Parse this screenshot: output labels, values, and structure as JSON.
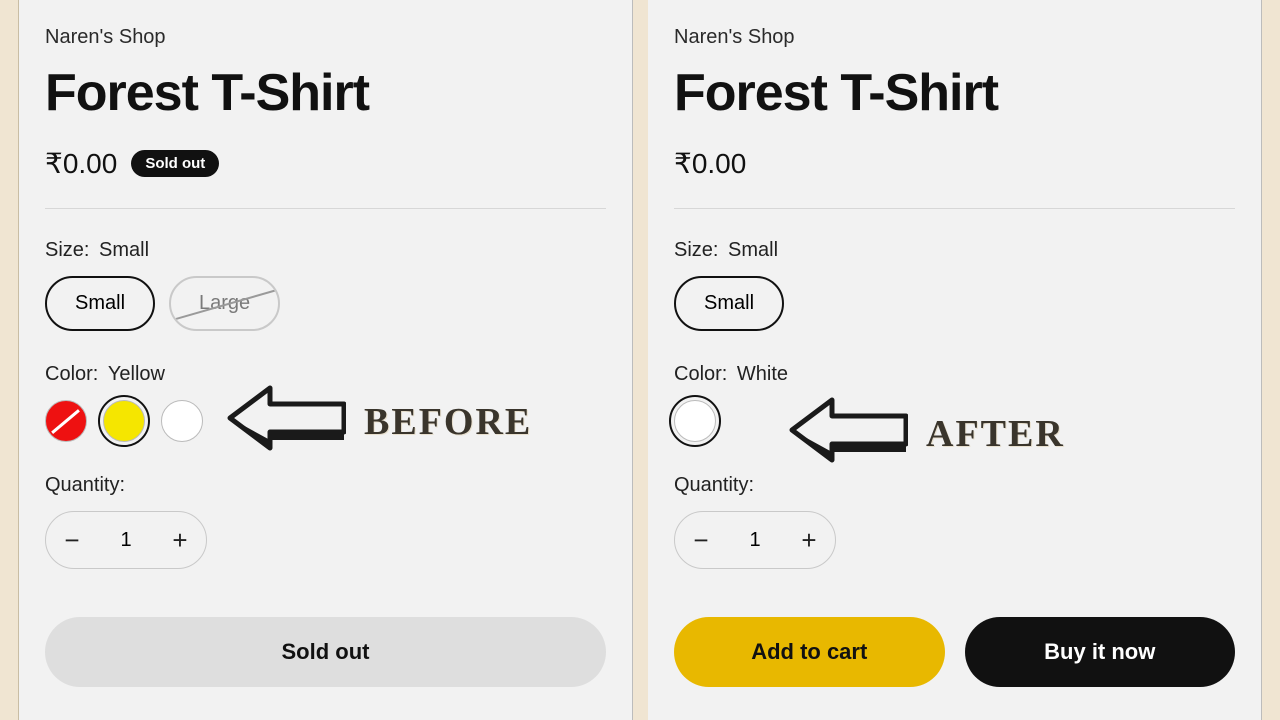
{
  "annotations": {
    "before": "BEFORE",
    "after": "AFTER"
  },
  "before": {
    "shop": "Naren's Shop",
    "title": "Forest T-Shirt",
    "price": "₹0.00",
    "soldout_badge": "Sold out",
    "size_label": "Size:",
    "size_value": "Small",
    "sizes": {
      "small": "Small",
      "large": "Large"
    },
    "color_label": "Color:",
    "color_value": "Yellow",
    "qty_label": "Quantity:",
    "qty": "1",
    "cta_soldout": "Sold out"
  },
  "after": {
    "shop": "Naren's Shop",
    "title": "Forest T-Shirt",
    "price": "₹0.00",
    "size_label": "Size:",
    "size_value": "Small",
    "sizes": {
      "small": "Small"
    },
    "color_label": "Color:",
    "color_value": "White",
    "qty_label": "Quantity:",
    "qty": "1",
    "cta_add": "Add to cart",
    "cta_buy": "Buy it now"
  }
}
